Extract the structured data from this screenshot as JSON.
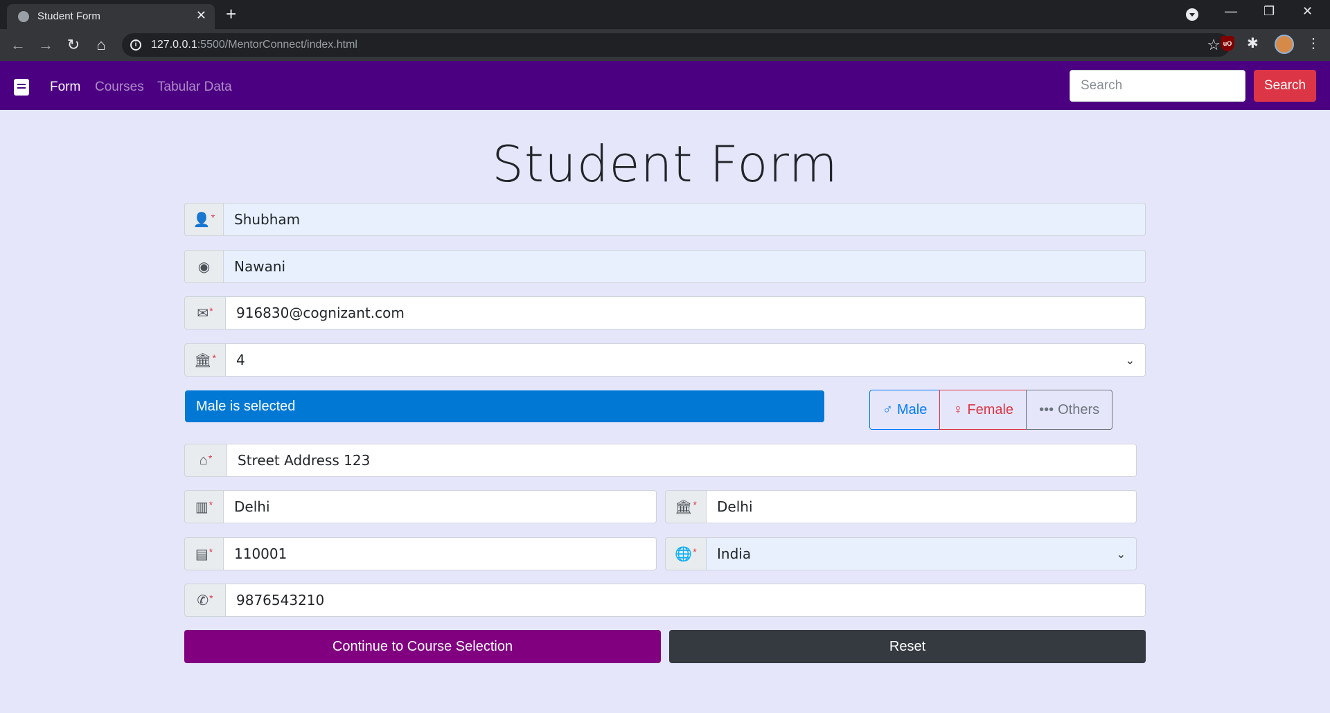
{
  "browser": {
    "tab_title": "Student Form",
    "url_host": "127.0.0.1",
    "url_path": ":5500/MentorConnect/index.html"
  },
  "navbar": {
    "links": [
      "Form",
      "Courses",
      "Tabular Data"
    ],
    "search_placeholder": "Search",
    "search_button": "Search",
    "brand_color": "#4b0082"
  },
  "form": {
    "title": "Student Form",
    "first_name": "Shubham",
    "last_name": "Nawani",
    "email": "916830@cognizant.com",
    "year": "4",
    "gender_alert": "Male is selected",
    "gender_options": [
      "Male",
      "Female",
      "Others"
    ],
    "address": "Street Address 123",
    "city": "Delhi",
    "state": "Delhi",
    "pincode": "110001",
    "country": "India",
    "phone": "9876543210",
    "required_marker": "*",
    "continue_label": "Continue to Course Selection",
    "reset_label": "Reset"
  },
  "colors": {
    "alert": "#0078d4",
    "continue": "#800080",
    "reset": "#343a40",
    "search_button": "#dc3545",
    "page_background": "#e6e6fa"
  }
}
